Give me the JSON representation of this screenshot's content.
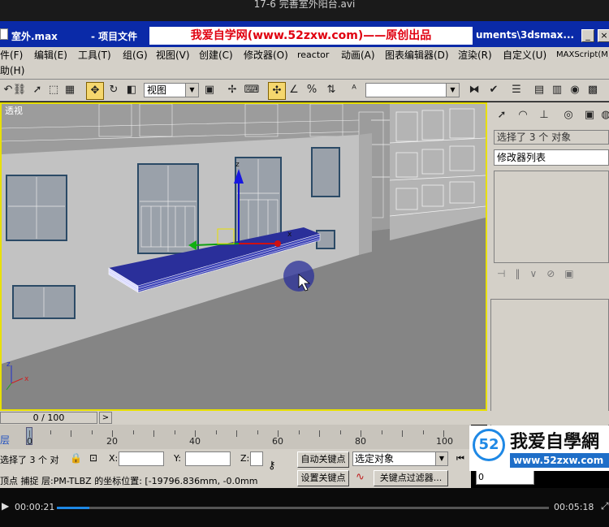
{
  "player": {
    "title": "17-6 完善室外阳台.avi",
    "current_time": "00:00:21",
    "total_time": "00:05:18",
    "progress_fraction": 0.066
  },
  "window": {
    "title_left": "室外.max",
    "title_mid": "- 项目文件",
    "title_right": "uments\\3dsmax...",
    "banner": "我爱自学网(www.52zxw.com)——原创出品",
    "min_label": "_",
    "close_label": "×"
  },
  "menu": {
    "row1": [
      "件(F)",
      "编辑(E)",
      "工具(T)",
      "组(G)",
      "视图(V)",
      "创建(C)",
      "修改器(O)",
      "reactor",
      "动画(A)",
      "图表编辑器(D)",
      "渲染(R)",
      "自定义(U)",
      "MAXScript(M)"
    ],
    "row2": [
      "助(H)"
    ]
  },
  "toolbar": {
    "view_dropdown": "视图",
    "named_selection": ""
  },
  "viewport": {
    "label": "透视",
    "axis_x": "x",
    "axis_y": "y",
    "axis_z": "z"
  },
  "command_panel": {
    "selection_info": "选择了 3 个 对象",
    "modifier_list": "修改器列表"
  },
  "time": {
    "frame_counter": "0 / 100",
    "next_label": ">",
    "ticks": [
      "0",
      "20",
      "40",
      "60",
      "80",
      "100"
    ]
  },
  "status": {
    "left_label": "层",
    "selection": "选择了 3 个 对",
    "x_label": "X:",
    "y_label": "Y:",
    "z_label": "Z:",
    "prompt": "顶点 捕捉 层:PM-TLBZ 的坐标位置: [-19796.836mm, -0.0mm",
    "auto_key": "自动关键点",
    "set_key": "设置关键点",
    "selected_object": "选定对象",
    "key_filters": "关键点过滤器...",
    "spinner_value": "0"
  },
  "logo": {
    "text": "我爱自學網",
    "url": "www.52zxw.com",
    "badge": "52"
  },
  "colors": {
    "titlebar": "#0a2aa8",
    "banner_text": "#e00010",
    "viewport_border": "#e8e000",
    "balcony": "#2a2f9a",
    "progress": "#1e88e5"
  }
}
